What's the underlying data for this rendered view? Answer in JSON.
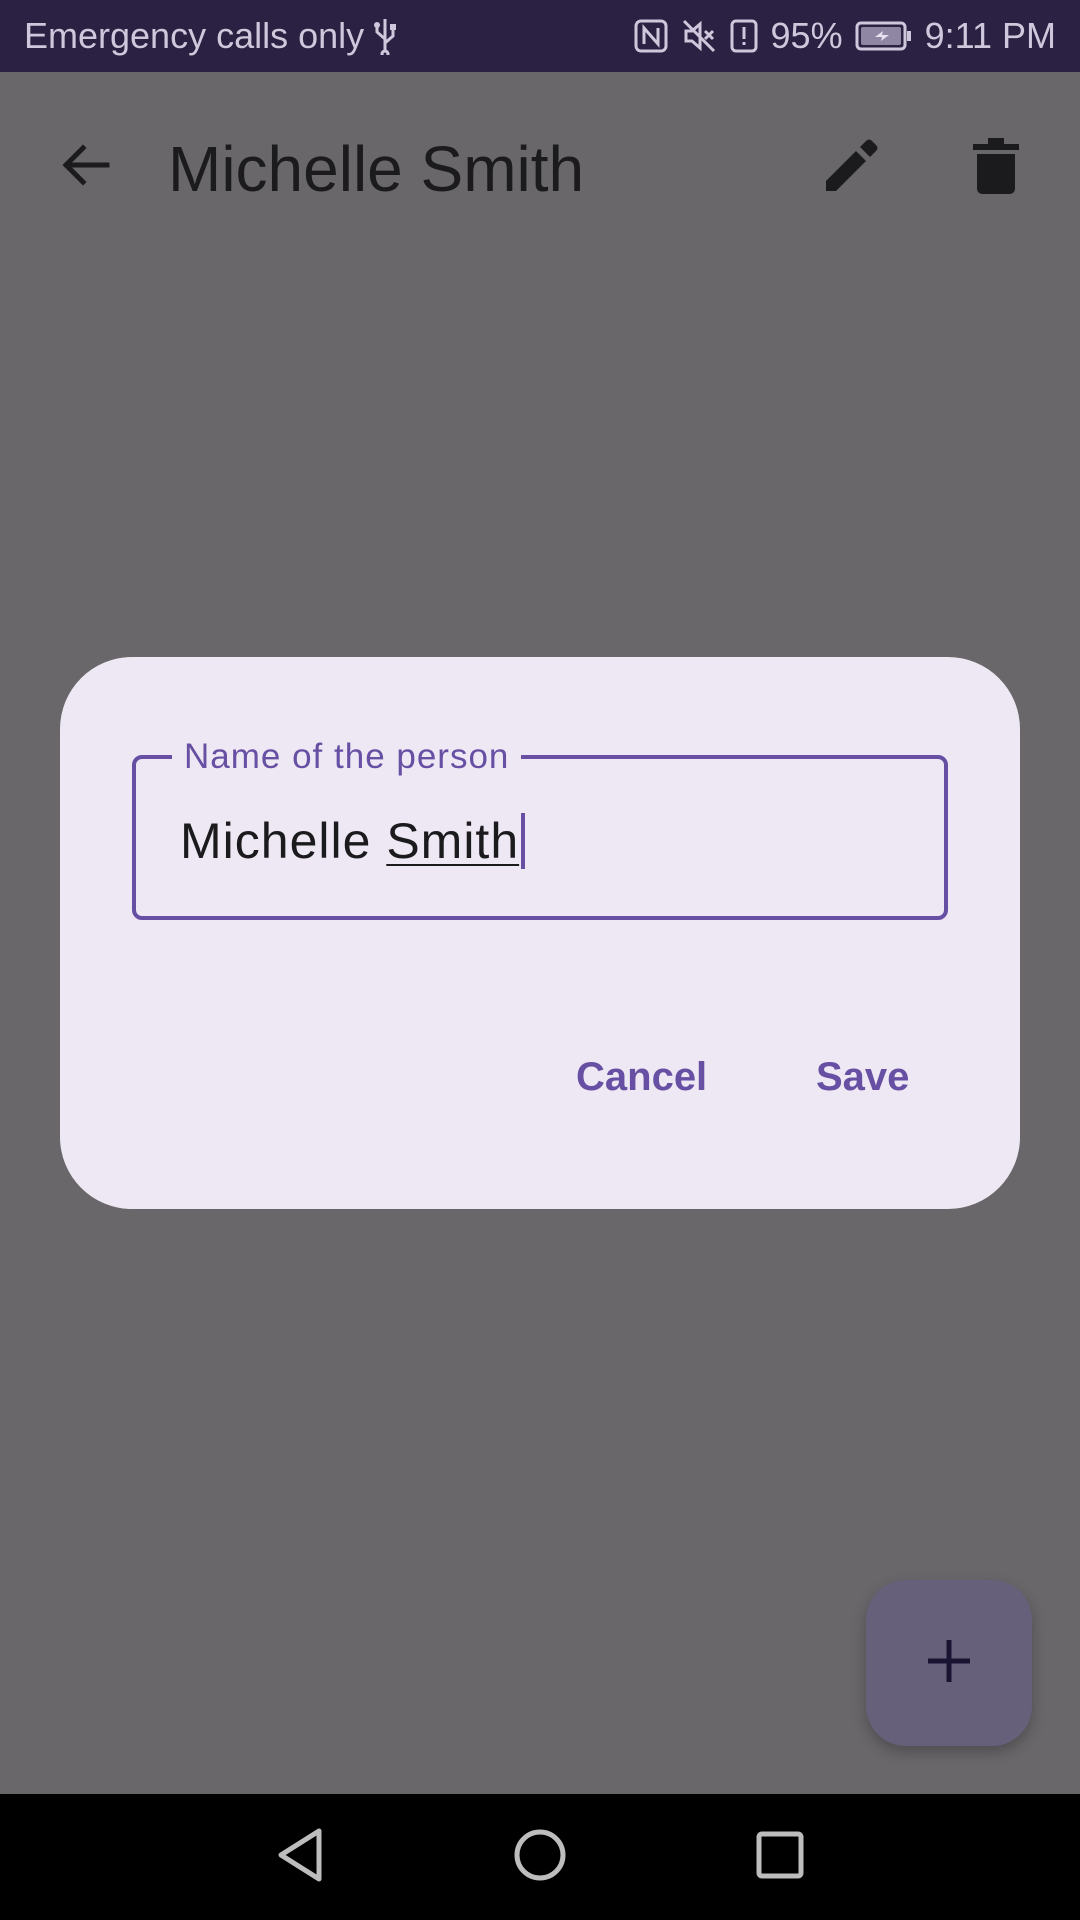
{
  "status_bar": {
    "carrier_text": "Emergency calls only",
    "battery_percent": "95%",
    "time": "9:11 PM",
    "icons": [
      "usb-icon",
      "nfc-icon",
      "mute-icon",
      "battery-alert-icon",
      "battery-charging-icon"
    ]
  },
  "app_bar": {
    "title": "Michelle Smith",
    "icons": [
      "back-arrow-icon",
      "edit-pencil-icon",
      "delete-trash-icon"
    ]
  },
  "dialog": {
    "field_label": "Name of the person",
    "field_value_first": "Michelle",
    "field_value_last": "Smith",
    "cancel_label": "Cancel",
    "save_label": "Save"
  },
  "fab": {
    "icon": "plus-icon"
  },
  "nav_bar": {
    "icons": [
      "nav-back-icon",
      "nav-home-icon",
      "nav-recents-icon"
    ]
  },
  "colors": {
    "accent": "#6750a4",
    "status_bar_bg": "#2b2142",
    "scrim_bg": "#6a676b",
    "dialog_bg": "#ede8f3",
    "fab_bg": "#66607a"
  }
}
